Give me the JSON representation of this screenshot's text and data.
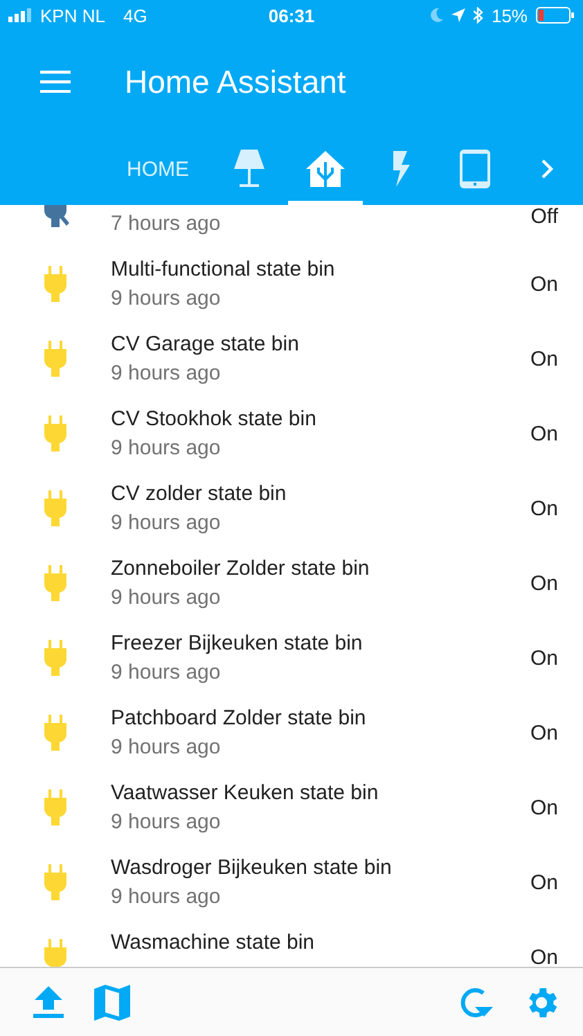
{
  "status_bar": {
    "carrier": "KPN NL",
    "network": "4G",
    "time": "06:31",
    "battery": "15%"
  },
  "header": {
    "title": "Home Assistant"
  },
  "tabs": [
    {
      "kind": "text",
      "label": "HOME",
      "selected": false
    },
    {
      "kind": "icon",
      "selected": false
    },
    {
      "kind": "icon",
      "selected": true
    },
    {
      "kind": "icon",
      "selected": false
    },
    {
      "kind": "icon",
      "selected": false
    }
  ],
  "entities": [
    {
      "time": "7 hours ago",
      "state": "Off",
      "on": false
    },
    {
      "name": "Multi-functional state bin",
      "time": "9 hours ago",
      "state": "On",
      "on": true
    },
    {
      "name": "CV Garage state bin",
      "time": "9 hours ago",
      "state": "On",
      "on": true
    },
    {
      "name": "CV Stookhok state bin",
      "time": "9 hours ago",
      "state": "On",
      "on": true
    },
    {
      "name": "CV zolder state bin",
      "time": "9 hours ago",
      "state": "On",
      "on": true
    },
    {
      "name": "Zonneboiler Zolder state bin",
      "time": "9 hours ago",
      "state": "On",
      "on": true
    },
    {
      "name": "Freezer Bijkeuken state bin",
      "time": "9 hours ago",
      "state": "On",
      "on": true
    },
    {
      "name": "Patchboard Zolder state bin",
      "time": "9 hours ago",
      "state": "On",
      "on": true
    },
    {
      "name": "Vaatwasser Keuken state bin",
      "time": "9 hours ago",
      "state": "On",
      "on": true
    },
    {
      "name": "Wasdroger Bijkeuken state bin",
      "time": "9 hours ago",
      "state": "On",
      "on": true
    },
    {
      "name": "Wasmachine state bin",
      "state": "On",
      "on": true
    }
  ]
}
